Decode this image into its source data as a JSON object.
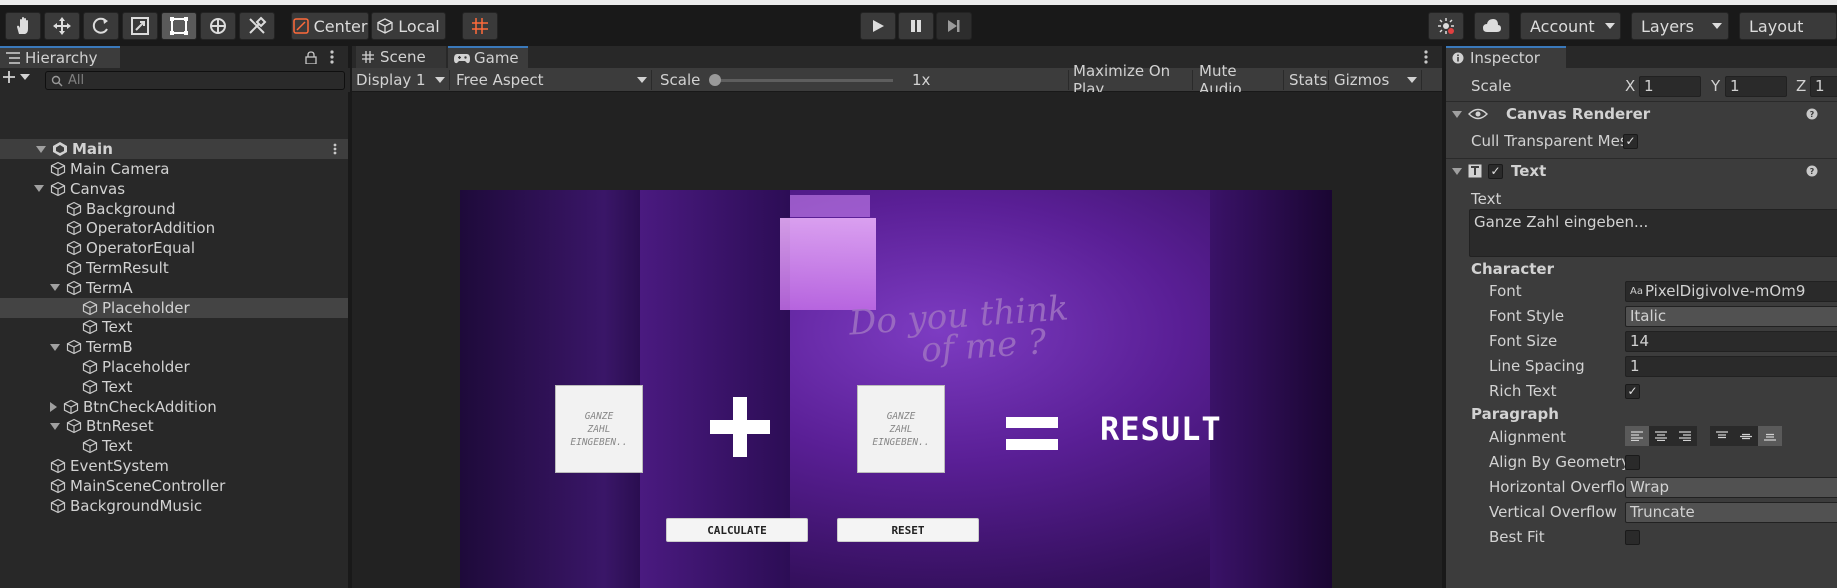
{
  "toolbar": {
    "pivot_center": "Center",
    "pivot_local": "Local",
    "account": "Account",
    "layers": "Layers",
    "layout": "Layout"
  },
  "hierarchy": {
    "tab": "Hierarchy",
    "search_placeholder": "All",
    "scene": "Main",
    "items": [
      {
        "label": "Main Camera",
        "indent": 1,
        "expand": "none",
        "selected": false
      },
      {
        "label": "Canvas",
        "indent": 1,
        "expand": "open",
        "selected": false
      },
      {
        "label": "Background",
        "indent": 2,
        "expand": "none",
        "selected": false
      },
      {
        "label": "OperatorAddition",
        "indent": 2,
        "expand": "none",
        "selected": false
      },
      {
        "label": "OperatorEqual",
        "indent": 2,
        "expand": "none",
        "selected": false
      },
      {
        "label": "TermResult",
        "indent": 2,
        "expand": "none",
        "selected": false
      },
      {
        "label": "TermA",
        "indent": 2,
        "expand": "open",
        "selected": false
      },
      {
        "label": "Placeholder",
        "indent": 3,
        "expand": "none",
        "selected": true
      },
      {
        "label": "Text",
        "indent": 3,
        "expand": "none",
        "selected": false
      },
      {
        "label": "TermB",
        "indent": 2,
        "expand": "open",
        "selected": false
      },
      {
        "label": "Placeholder",
        "indent": 3,
        "expand": "none",
        "selected": false
      },
      {
        "label": "Text",
        "indent": 3,
        "expand": "none",
        "selected": false
      },
      {
        "label": "BtnCheckAddition",
        "indent": 2,
        "expand": "closed",
        "selected": false
      },
      {
        "label": "BtnReset",
        "indent": 2,
        "expand": "open",
        "selected": false
      },
      {
        "label": "Text",
        "indent": 3,
        "expand": "none",
        "selected": false
      },
      {
        "label": "EventSystem",
        "indent": 1,
        "expand": "none",
        "selected": false
      },
      {
        "label": "MainSceneController",
        "indent": 1,
        "expand": "none",
        "selected": false
      },
      {
        "label": "BackgroundMusic",
        "indent": 1,
        "expand": "none",
        "selected": false
      }
    ]
  },
  "game": {
    "tab_scene": "Scene",
    "tab_game": "Game",
    "display": "Display 1",
    "aspect": "Free Aspect",
    "scale_label": "Scale",
    "scale_value": "1x",
    "maximize": "Maximize On Play",
    "mute": "Mute Audio",
    "stats": "Stats",
    "gizmos": "Gizmos",
    "scene": {
      "graffiti_line1": "Do you think",
      "graffiti_line2": "of me ?",
      "input_a": [
        "GANZE",
        "ZAHL",
        "EINGEBEN.."
      ],
      "input_b": [
        "GANZE",
        "ZAHL",
        "EINGEBEN.."
      ],
      "plus": "+",
      "equals": "=",
      "result": "RESULT",
      "calculate": "CALCULATE",
      "reset": "RESET"
    }
  },
  "inspector": {
    "tab": "Inspector",
    "scale_label": "Scale",
    "scale_x": "1",
    "scale_y": "1",
    "scale_z": "1",
    "canvas_renderer": "Canvas Renderer",
    "cull_label": "Cull Transparent Mes",
    "text_component": "Text",
    "text_label": "Text",
    "text_value": "Ganze Zahl eingeben...",
    "character": "Character",
    "font_label": "Font",
    "font_value": "PixelDigivolve-mOm9",
    "font_style_label": "Font Style",
    "font_style_value": "Italic",
    "font_size_label": "Font Size",
    "font_size_value": "14",
    "line_spacing_label": "Line Spacing",
    "line_spacing_value": "1",
    "rich_text_label": "Rich Text",
    "paragraph": "Paragraph",
    "alignment_label": "Alignment",
    "align_geometry_label": "Align By Geometry",
    "h_overflow_label": "Horizontal Overflo",
    "h_overflow_value": "Wrap",
    "v_overflow_label": "Vertical Overflow",
    "v_overflow_value": "Truncate",
    "best_fit_label": "Best Fit",
    "x": "X",
    "y": "Y",
    "z": "Z",
    "aa": "Aa"
  }
}
